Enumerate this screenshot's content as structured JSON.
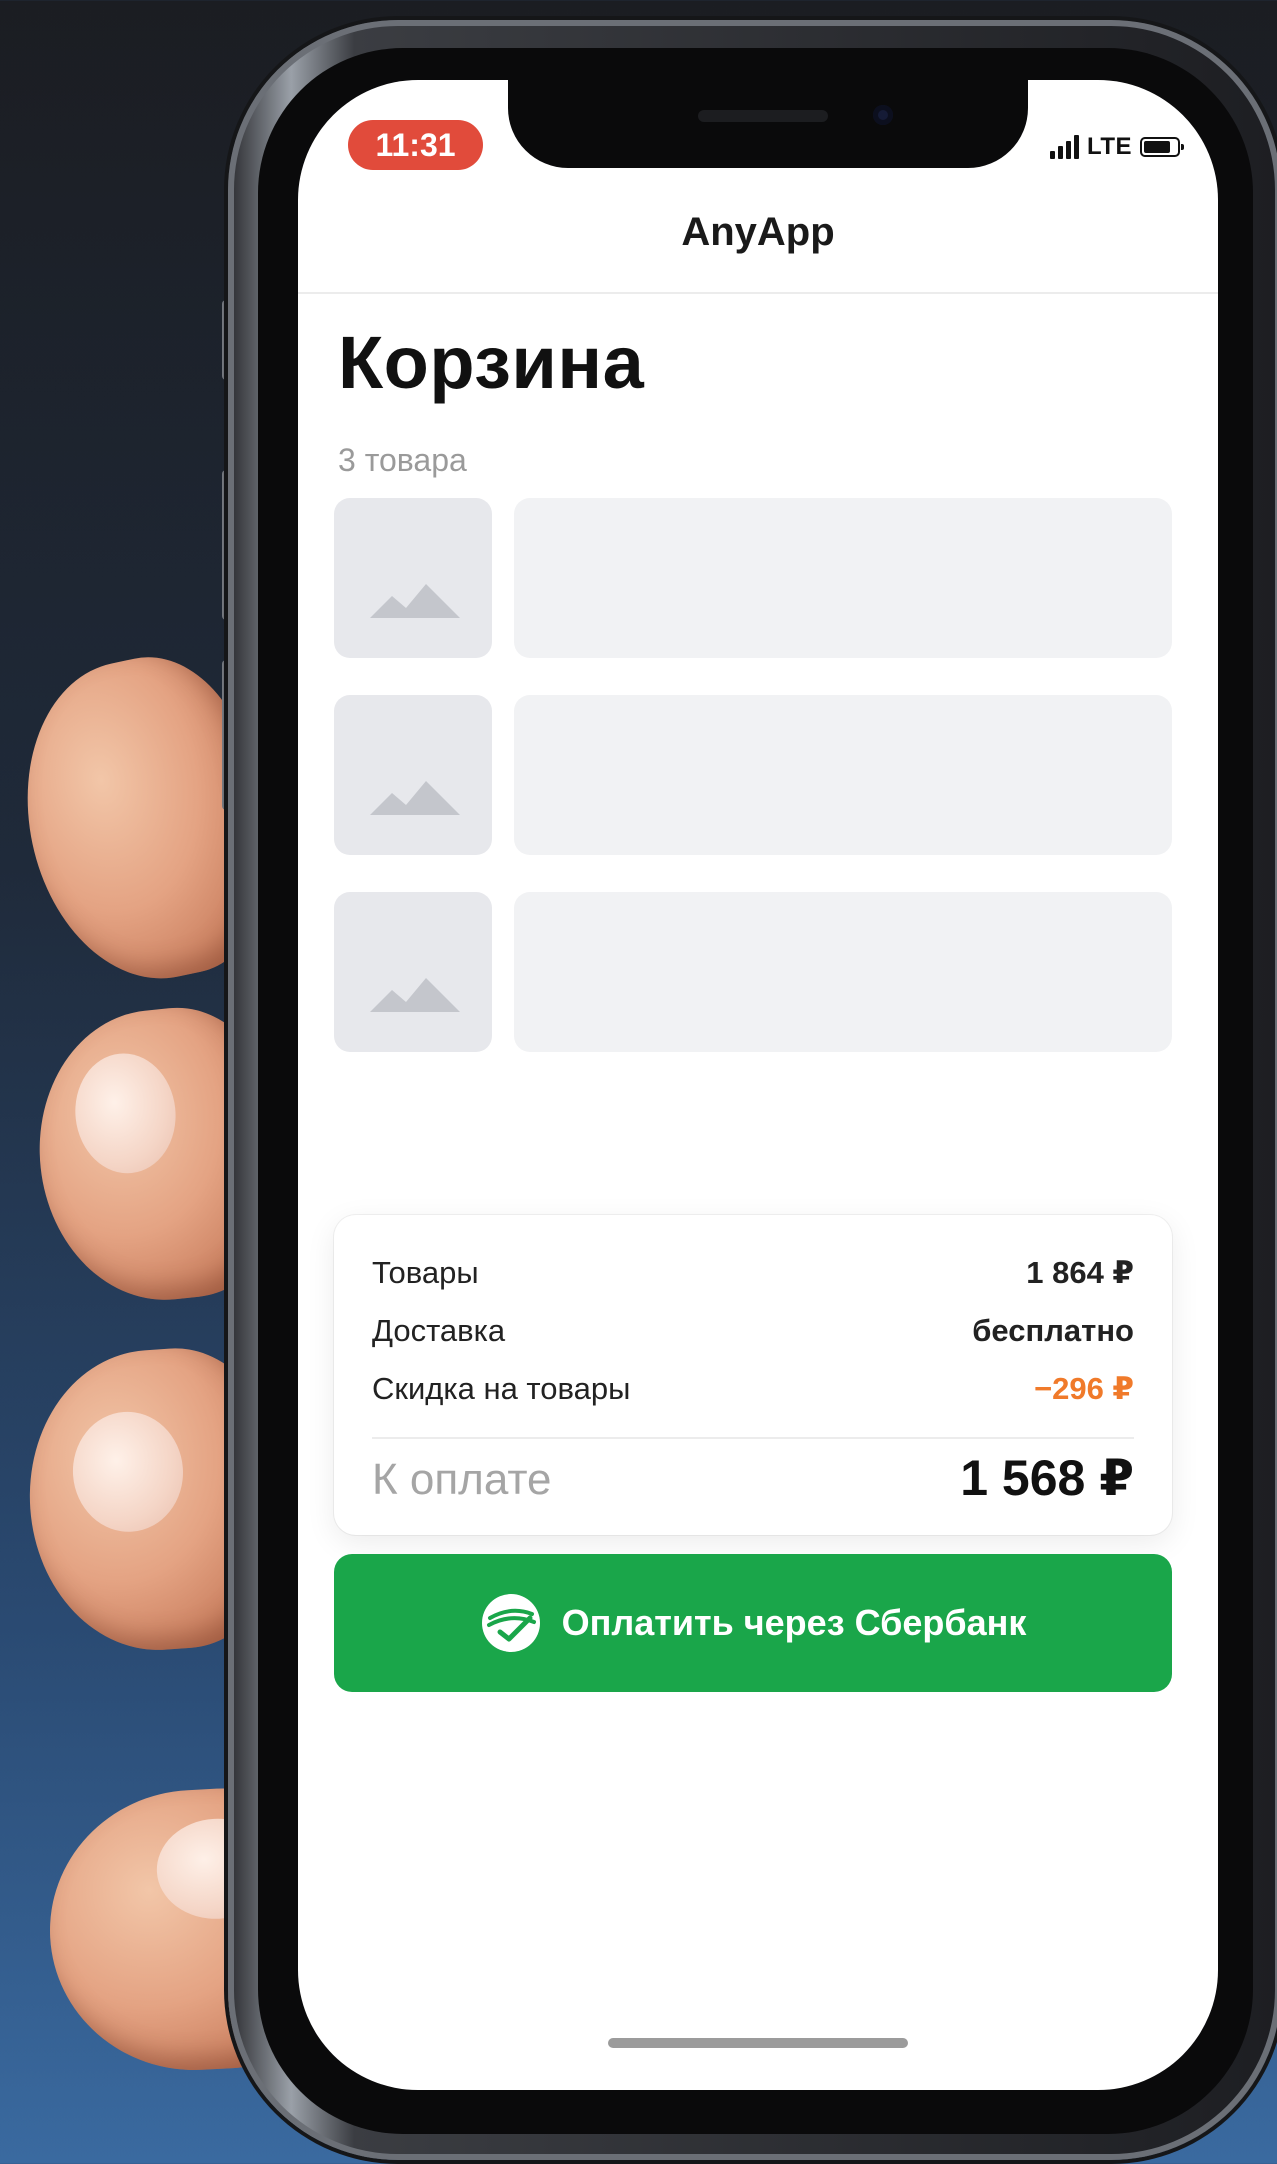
{
  "status_bar": {
    "time": "11:31",
    "network": "LTE"
  },
  "header": {
    "app_title": "AnyApp"
  },
  "cart": {
    "title": "Корзина",
    "items_count": "3 товара",
    "items": [
      {
        "thumb_icon": "image-placeholder-icon"
      },
      {
        "thumb_icon": "image-placeholder-icon"
      },
      {
        "thumb_icon": "image-placeholder-icon"
      }
    ]
  },
  "summary": {
    "goods_label": "Товары",
    "goods_value": "1 864 ₽",
    "delivery_label": "Доставка",
    "delivery_value": "бесплатно",
    "discount_label": "Скидка на товары",
    "discount_value": "−296 ₽",
    "total_label": "К оплате",
    "total_value": "1 568 ₽"
  },
  "pay_button": {
    "label": "Оплатить через Сбербанк",
    "icon": "sberbank-logo-icon"
  },
  "colors": {
    "accent_green": "#1aa64a",
    "discount_orange": "#f07a2a",
    "time_badge": "#e14b3b"
  }
}
